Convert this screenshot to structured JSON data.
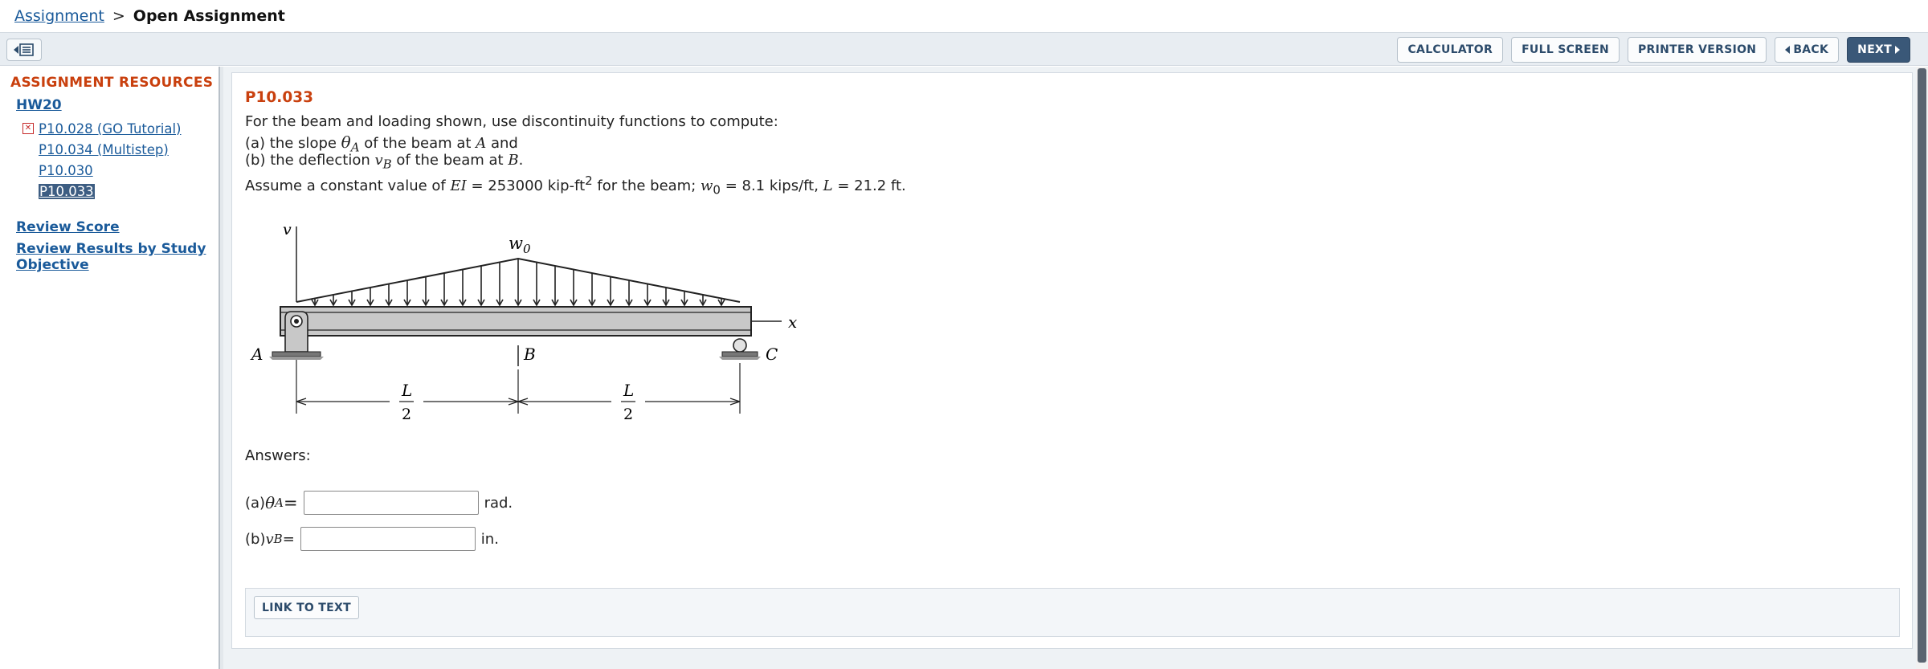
{
  "breadcrumb": {
    "parent": "Assignment",
    "separator": ">",
    "current": "Open Assignment"
  },
  "toolbar": {
    "calculator": "CALCULATOR",
    "full_screen": "FULL SCREEN",
    "printer_version": "PRINTER VERSION",
    "back": "BACK",
    "next": "NEXT"
  },
  "sidebar": {
    "title": "ASSIGNMENT RESOURCES",
    "homework": "HW20",
    "items": [
      {
        "label": "P10.028 (GO Tutorial)",
        "status": "incorrect"
      },
      {
        "label": "P10.034 (Multistep)",
        "status": "none"
      },
      {
        "label": "P10.030",
        "status": "none"
      },
      {
        "label": "P10.033",
        "status": "selected"
      }
    ],
    "review_score": "Review Score",
    "review_results": "Review Results by Study Objective"
  },
  "problem": {
    "id": "P10.033",
    "line1": "For the beam and loading shown, use discontinuity functions to compute:",
    "line2_a": "(a) the slope ",
    "line2_sym": "θ",
    "line2_sub": "A",
    "line2_b": " of the beam at ",
    "line2_pt": "A",
    "line2_c": " and",
    "line3_a": "(b) the deflection ",
    "line3_sym": "v",
    "line3_sub": "B",
    "line3_b": " of the beam at ",
    "line3_pt": "B",
    "line3_c": ".",
    "line4_a": "Assume a constant value of ",
    "line4_ei": "EI",
    "line4_b": " = 253000 kip-ft",
    "line4_sup": "2",
    "line4_c": " for the beam; ",
    "line4_w": "w",
    "line4_wsub": "0",
    "line4_d": " = 8.1 kips/ft, ",
    "line4_l": "L",
    "line4_e": " = 21.2 ft."
  },
  "figure": {
    "v_label": "v",
    "w_label": "w",
    "w_sub": "0",
    "x_label": "x",
    "a_label": "A",
    "b_label": "B",
    "c_label": "C",
    "l_top": "L",
    "l_bottom": "2"
  },
  "answers": {
    "label": "Answers:",
    "a_prefix": "(a) ",
    "a_sym": "θ",
    "a_sub": "A",
    "a_eq": " =",
    "a_value": "",
    "a_unit": "rad.",
    "b_prefix": "(b) ",
    "b_sym": "v",
    "b_sub": "B",
    "b_eq": " =",
    "b_value": "",
    "b_unit": "in."
  },
  "link_to_text": "LINK TO TEXT"
}
